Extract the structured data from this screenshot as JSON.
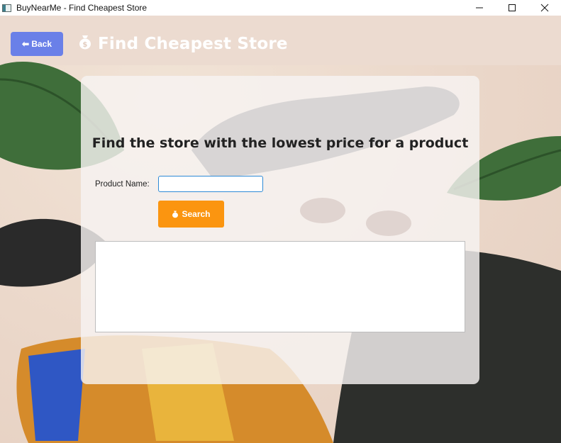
{
  "window": {
    "title": "BuyNearMe - Find Cheapest Store",
    "minimize": "—",
    "maximize": "☐",
    "close": "✕"
  },
  "header": {
    "back_label": "⬅ Back",
    "title": "Find Cheapest Store",
    "title_icon": "money-bag-icon"
  },
  "form": {
    "heading": "Find the store with the lowest price for a product",
    "product_label": "Product Name:",
    "product_value": "",
    "product_placeholder": "",
    "search_label": "Search",
    "search_icon": "money-bag-icon"
  },
  "results": {
    "text": ""
  }
}
